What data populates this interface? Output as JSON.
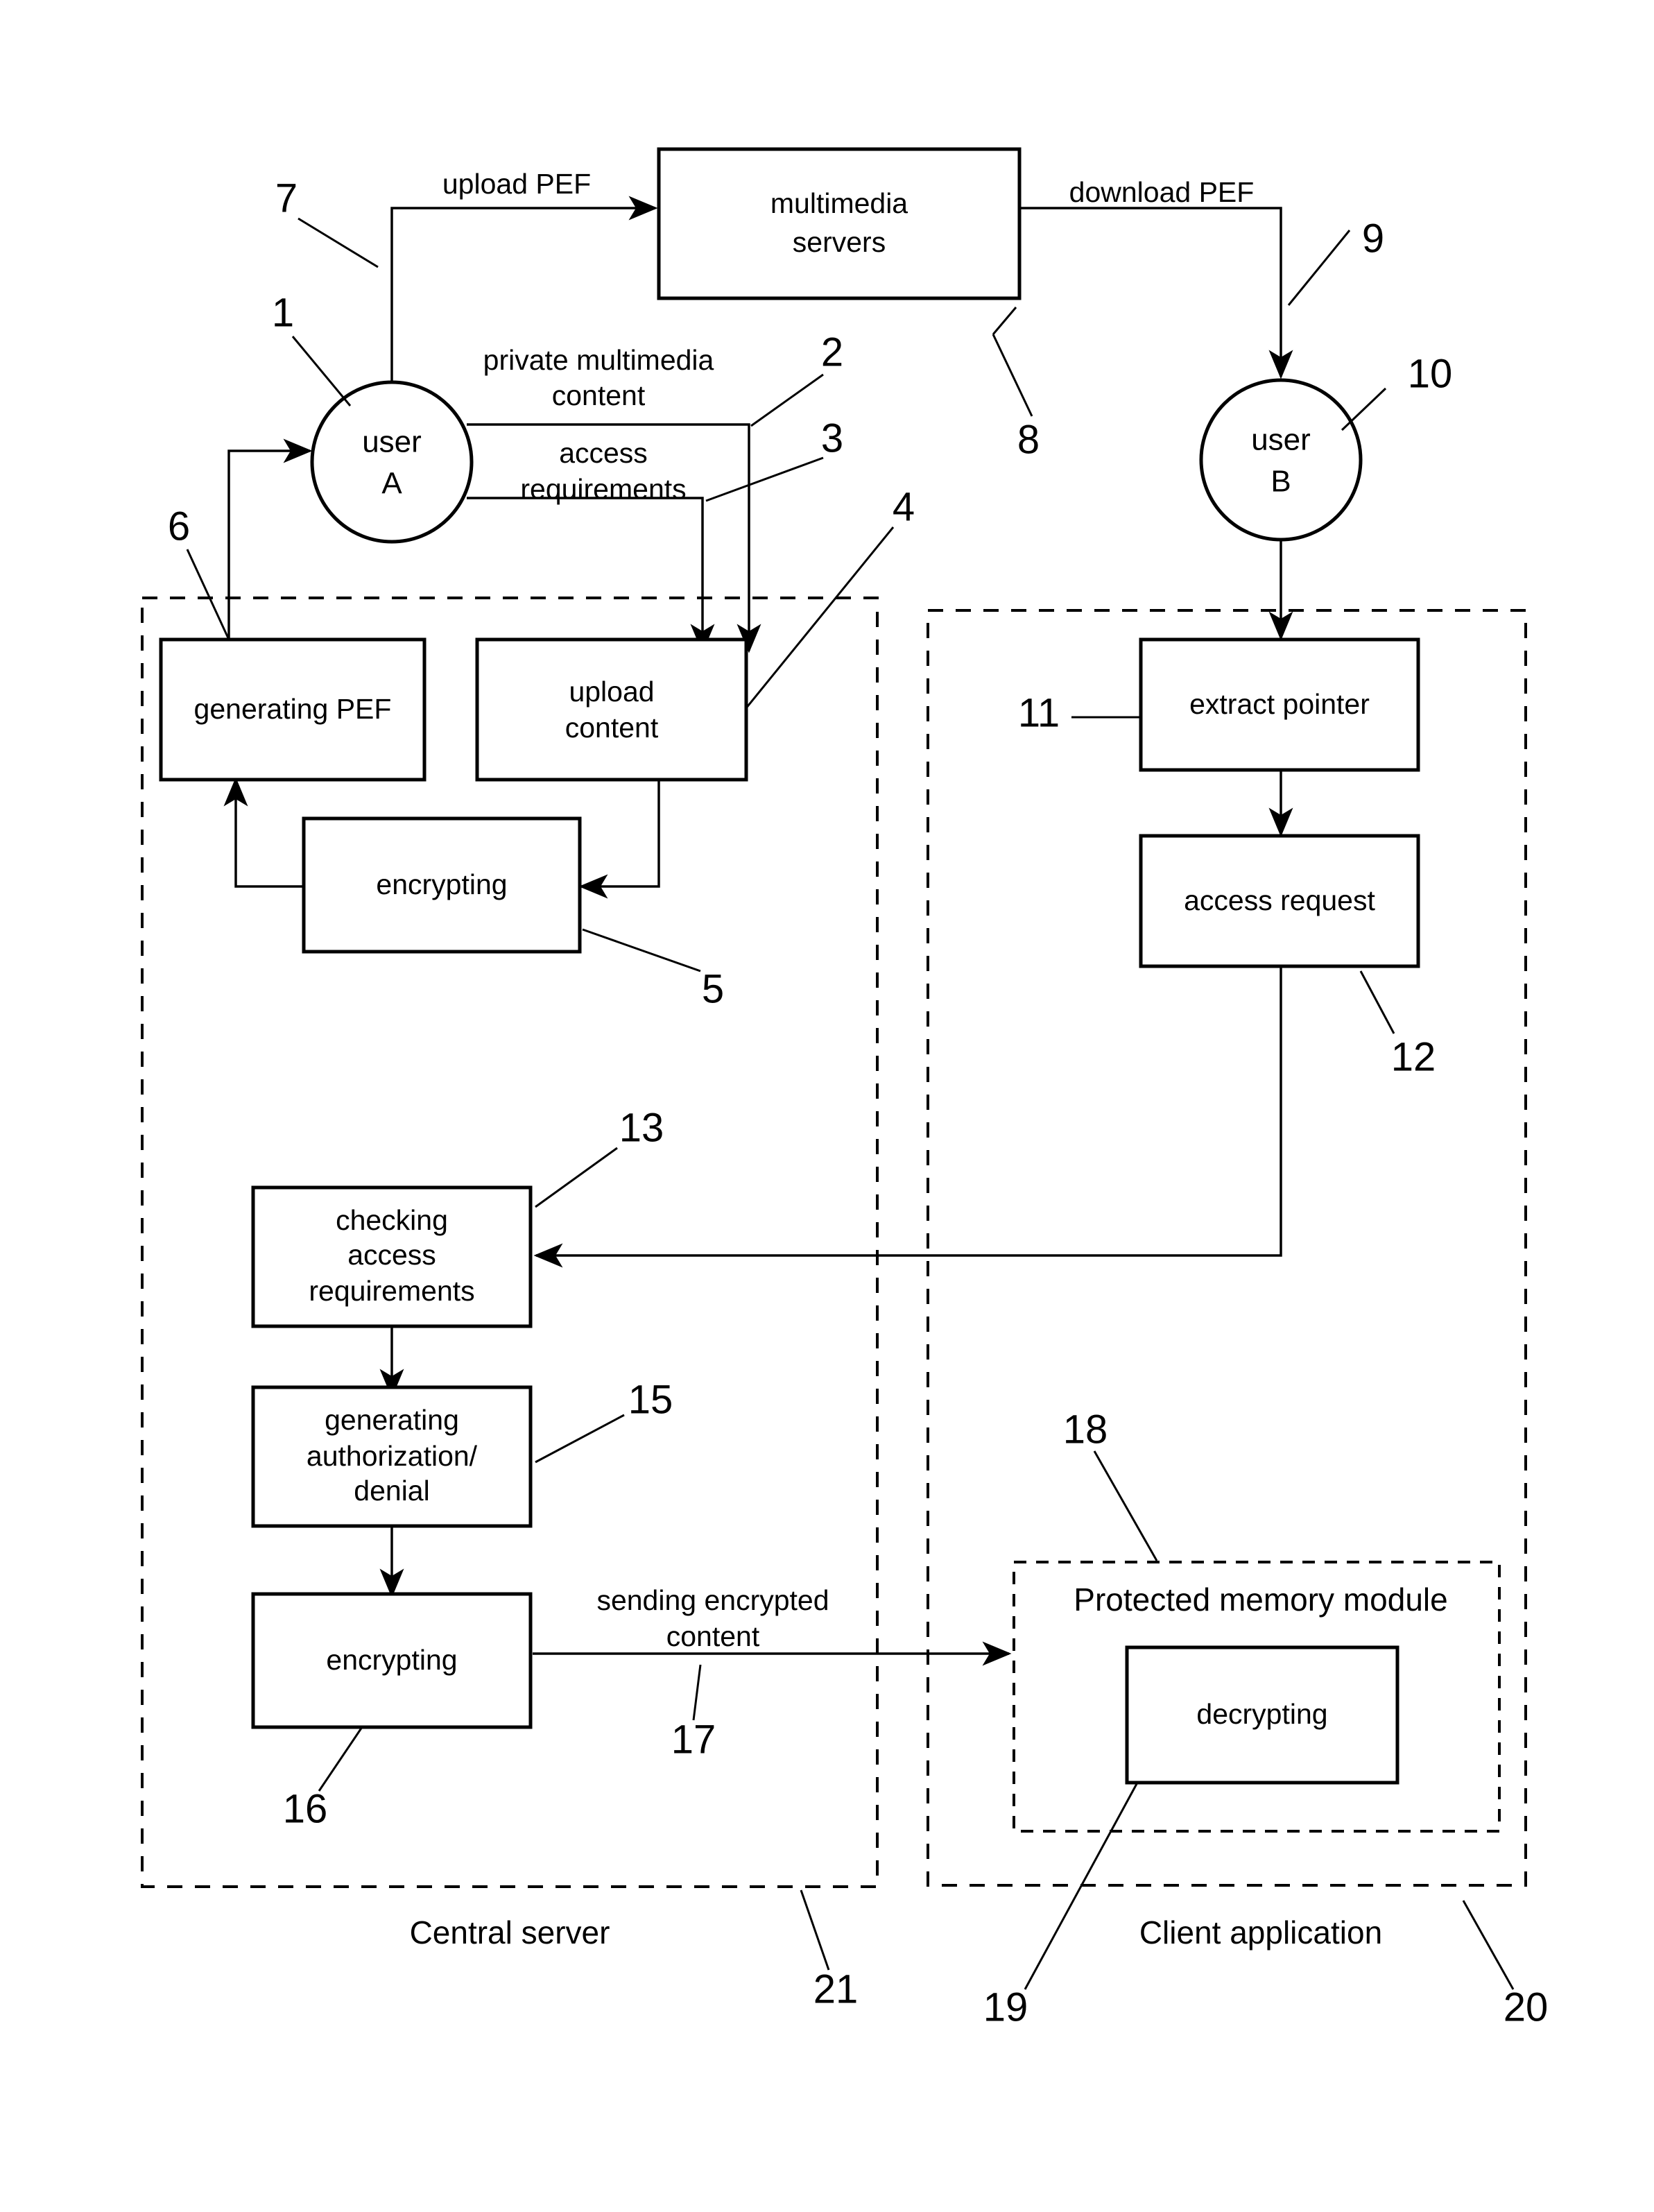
{
  "figure": {
    "title": "Private multimedia content sharing flow diagram",
    "actors": [
      {
        "id": "user_a",
        "label_line1": "user",
        "label_line2": "A",
        "ref": "1"
      },
      {
        "id": "user_b",
        "label_line1": "user",
        "label_line2": "B",
        "ref": "10"
      }
    ],
    "boxes": [
      {
        "id": "multimedia_servers",
        "label_line1": "multimedia",
        "label_line2": "servers",
        "ref": "8"
      },
      {
        "id": "generating_pef",
        "label_line1": "generating PEF",
        "label_line2": "",
        "ref": "6"
      },
      {
        "id": "upload_content",
        "label_line1": "upload",
        "label_line2": "content",
        "ref": "4"
      },
      {
        "id": "encrypting_client",
        "label_line1": "encrypting",
        "label_line2": "",
        "ref": "5"
      },
      {
        "id": "extract_pointer",
        "label_line1": "extract pointer",
        "label_line2": "",
        "ref": "11"
      },
      {
        "id": "access_request",
        "label_line1": "access request",
        "label_line2": "",
        "ref": "12"
      },
      {
        "id": "checking_access_requirements",
        "label_line1": "checking",
        "label_line2": "access",
        "label_line3": "requirements",
        "ref": "13"
      },
      {
        "id": "generating_authorization_denial",
        "label_line1": "generating",
        "label_line2": "authorization/",
        "label_line3": "denial",
        "ref": "15"
      },
      {
        "id": "encrypting_server",
        "label_line1": "encrypting",
        "label_line2": "",
        "ref": "16"
      },
      {
        "id": "decrypting",
        "label_line1": "decrypting",
        "label_line2": "",
        "ref": "19"
      }
    ],
    "regions": [
      {
        "id": "central_server",
        "label": "Central server",
        "ref": "21"
      },
      {
        "id": "client_application",
        "label": "Client application",
        "ref": "20"
      },
      {
        "id": "protected_memory_module",
        "label": "Protected memory module",
        "ref": "18"
      }
    ],
    "edge_labels": [
      {
        "id": "upload_pef",
        "text": "upload PEF",
        "ref": "7"
      },
      {
        "id": "download_pef",
        "text": "download PEF",
        "ref": "9"
      },
      {
        "id": "private_multimedia_content",
        "line1": "private multimedia",
        "line2": "content",
        "ref": "2"
      },
      {
        "id": "access_requirements",
        "line1": "access",
        "line2": "requirements",
        "ref": "3"
      },
      {
        "id": "sending_encrypted_content",
        "line1": "sending encrypted",
        "line2": "content",
        "ref": "17"
      }
    ],
    "reference_numerals": [
      "1",
      "2",
      "3",
      "4",
      "5",
      "6",
      "7",
      "8",
      "9",
      "10",
      "11",
      "12",
      "13",
      "15",
      "16",
      "17",
      "18",
      "19",
      "20",
      "21"
    ],
    "colors": {
      "stroke": "#000000",
      "background": "#ffffff"
    }
  }
}
